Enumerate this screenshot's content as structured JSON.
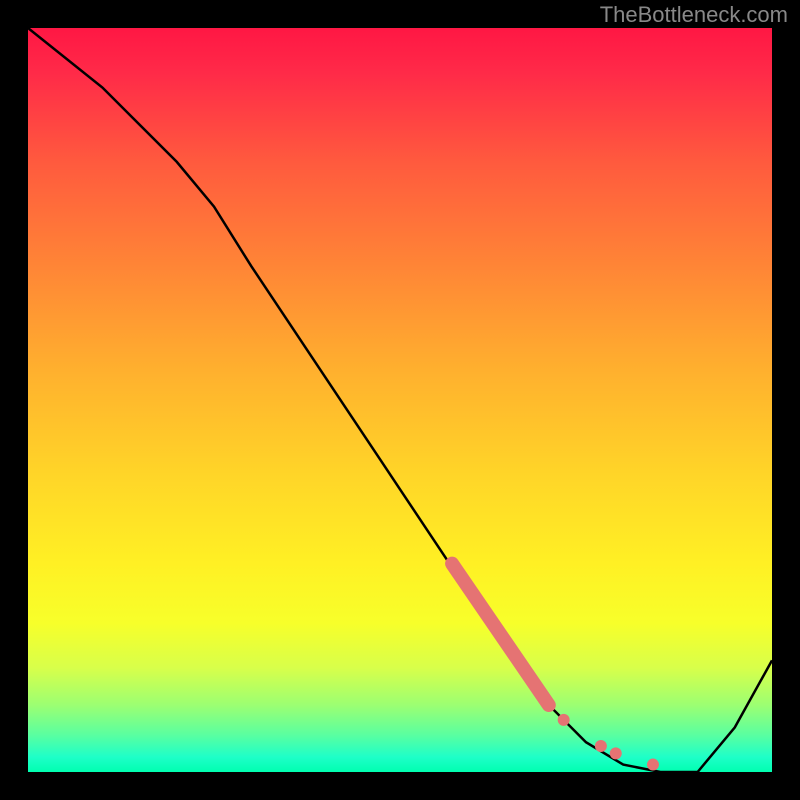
{
  "watermark": "TheBottleneck.com",
  "chart_data": {
    "type": "line",
    "title": "",
    "xlabel": "",
    "ylabel": "",
    "xlim": [
      0,
      100
    ],
    "ylim": [
      0,
      100
    ],
    "series": [
      {
        "name": "curve",
        "x": [
          0,
          10,
          20,
          25,
          30,
          40,
          50,
          60,
          65,
          70,
          75,
          80,
          85,
          90,
          95,
          100
        ],
        "y": [
          100,
          92,
          82,
          76,
          68,
          53,
          38,
          23,
          16,
          9,
          4,
          1,
          0,
          0,
          6,
          15
        ]
      }
    ],
    "highlight_band": {
      "name": "thick-red-segment",
      "x": [
        57,
        70
      ],
      "y": [
        28,
        9
      ]
    },
    "highlight_dots": {
      "name": "dots",
      "points": [
        {
          "x": 72,
          "y": 7
        },
        {
          "x": 77,
          "y": 3.5
        },
        {
          "x": 79,
          "y": 2.5
        },
        {
          "x": 84,
          "y": 1
        }
      ]
    },
    "gradient_stops": [
      {
        "offset": 0.0,
        "color": "#ff1744"
      },
      {
        "offset": 0.06,
        "color": "#ff2a48"
      },
      {
        "offset": 0.18,
        "color": "#ff5a3e"
      },
      {
        "offset": 0.32,
        "color": "#ff8536"
      },
      {
        "offset": 0.46,
        "color": "#ffb02e"
      },
      {
        "offset": 0.6,
        "color": "#ffd528"
      },
      {
        "offset": 0.72,
        "color": "#fff024"
      },
      {
        "offset": 0.8,
        "color": "#f7ff2a"
      },
      {
        "offset": 0.86,
        "color": "#d8ff4a"
      },
      {
        "offset": 0.91,
        "color": "#9cff72"
      },
      {
        "offset": 0.95,
        "color": "#5affa0"
      },
      {
        "offset": 0.98,
        "color": "#1effc8"
      },
      {
        "offset": 1.0,
        "color": "#00ffb0"
      }
    ]
  }
}
